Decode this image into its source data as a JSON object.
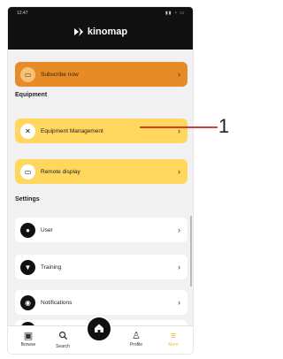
{
  "app": {
    "brand": "kinomap"
  },
  "status": {
    "time": "12:47",
    "icons": "▮▮ ◔ ▭"
  },
  "subscribe": {
    "label": "Subscribe now"
  },
  "sections": {
    "equipment": "Equipment",
    "settings": "Settings"
  },
  "equipment": {
    "management_label": "Equipment Management",
    "remote_label": "Remote display"
  },
  "settings_items": {
    "user": "User",
    "training": "Training",
    "notifications": "Notifications"
  },
  "tabs": {
    "browse": "Browse",
    "search": "Search",
    "profile": "Profile",
    "more": "More"
  },
  "annotation": {
    "number": "1"
  },
  "colors": {
    "header": "#111111",
    "subscribe": "#e78a28",
    "accent_yellow": "#ffd75e",
    "callout": "#d63b2d"
  },
  "icons": {
    "subscribe": "card-icon",
    "equipment": "tools-icon",
    "remote": "monitor-icon",
    "user": "user-icon",
    "training": "trophy-icon",
    "notifications": "bell-icon",
    "home": "home-icon"
  }
}
